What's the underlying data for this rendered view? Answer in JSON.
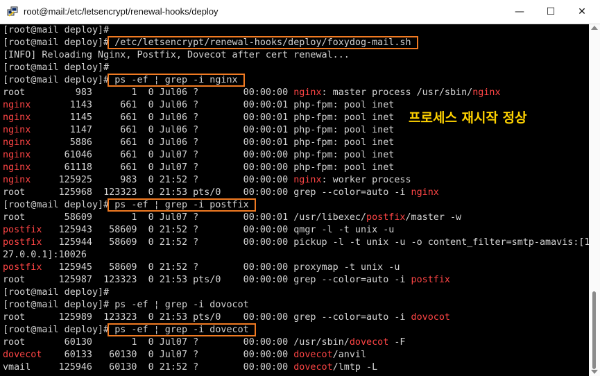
{
  "window": {
    "title": "root@mail:/etc/letsencrypt/renewal-hooks/deploy",
    "minimize_glyph": "—",
    "maximize_glyph": "☐",
    "close_glyph": "✕"
  },
  "annotation": "프로세스 재시작 정상",
  "colors": {
    "highlight_text": "#ff4545",
    "box_outline": "#f07a22",
    "annotation": "#ffd200"
  },
  "terminal": {
    "lines": [
      {
        "segs": [
          {
            "t": "[root@mail deploy]#"
          }
        ]
      },
      {
        "segs": [
          {
            "t": "[root@mail deploy]#"
          },
          {
            "t": " /etc/letsencrypt/renewal-hooks/deploy/foxydog-mail.sh ",
            "box": true
          }
        ]
      },
      {
        "segs": [
          {
            "t": "[INFO] Reloading Nginx, Postfix, Dovecot after cert renewal..."
          }
        ]
      },
      {
        "segs": [
          {
            "t": "[root@mail deploy]#"
          }
        ]
      },
      {
        "segs": [
          {
            "t": "[root@mail deploy]#"
          },
          {
            "t": " ps -ef ¦ grep -i nginx ",
            "box": true
          }
        ]
      },
      {
        "segs": [
          {
            "t": "root         983       1  0 Jul06 ?        00:00:00 "
          },
          {
            "t": "nginx",
            "red": true
          },
          {
            "t": ": master process /usr/sbin/"
          },
          {
            "t": "nginx",
            "red": true
          }
        ]
      },
      {
        "segs": [
          {
            "t": "nginx",
            "red": true
          },
          {
            "t": "       1143     661  0 Jul06 ?        00:00:01 php-fpm: pool inet"
          }
        ]
      },
      {
        "segs": [
          {
            "t": "nginx",
            "red": true
          },
          {
            "t": "       1145     661  0 Jul06 ?        00:00:01 php-fpm: pool inet"
          }
        ]
      },
      {
        "segs": [
          {
            "t": "nginx",
            "red": true
          },
          {
            "t": "       1147     661  0 Jul06 ?        00:00:01 php-fpm: pool inet"
          }
        ]
      },
      {
        "segs": [
          {
            "t": "nginx",
            "red": true
          },
          {
            "t": "       5886     661  0 Jul06 ?        00:00:01 php-fpm: pool inet"
          }
        ]
      },
      {
        "segs": [
          {
            "t": "nginx",
            "red": true
          },
          {
            "t": "      61046     661  0 Jul07 ?        00:00:00 php-fpm: pool inet"
          }
        ]
      },
      {
        "segs": [
          {
            "t": "nginx",
            "red": true
          },
          {
            "t": "      61118     661  0 Jul07 ?        00:00:00 php-fpm: pool inet"
          }
        ]
      },
      {
        "segs": [
          {
            "t": "nginx",
            "red": true
          },
          {
            "t": "     125925     983  0 21:52 ?        00:00:00 "
          },
          {
            "t": "nginx",
            "red": true
          },
          {
            "t": ": worker process"
          }
        ]
      },
      {
        "segs": [
          {
            "t": "root      125968  123323  0 21:53 pts/0    00:00:00 grep --color=auto -i "
          },
          {
            "t": "nginx",
            "red": true
          }
        ]
      },
      {
        "segs": [
          {
            "t": "[root@mail deploy]#"
          },
          {
            "t": " ps -ef ¦ grep -i postfix ",
            "box": true
          }
        ]
      },
      {
        "segs": [
          {
            "t": "root       58609       1  0 Jul07 ?        00:00:01 /usr/libexec/"
          },
          {
            "t": "postfix",
            "red": true
          },
          {
            "t": "/master -w"
          }
        ]
      },
      {
        "segs": [
          {
            "t": "postfix",
            "red": true
          },
          {
            "t": "   125943   58609  0 21:52 ?        00:00:00 qmgr -l -t unix -u"
          }
        ]
      },
      {
        "segs": [
          {
            "t": "postfix",
            "red": true
          },
          {
            "t": "   125944   58609  0 21:52 ?        00:00:00 pickup -l -t unix -u -o content_filter=smtp-amavis:[1"
          }
        ]
      },
      {
        "segs": [
          {
            "t": "27.0.0.1]:10026"
          }
        ]
      },
      {
        "segs": [
          {
            "t": "postfix",
            "red": true
          },
          {
            "t": "   125945   58609  0 21:52 ?        00:00:00 proxymap -t unix -u"
          }
        ]
      },
      {
        "segs": [
          {
            "t": "root      125987  123323  0 21:53 pts/0    00:00:00 grep --color=auto -i "
          },
          {
            "t": "postfix",
            "red": true
          }
        ]
      },
      {
        "segs": [
          {
            "t": "[root@mail deploy]#"
          }
        ]
      },
      {
        "segs": [
          {
            "t": "[root@mail deploy]# ps -ef ¦ grep -i dovocot"
          }
        ]
      },
      {
        "segs": [
          {
            "t": "root      125989  123323  0 21:53 pts/0    00:00:00 grep --color=auto -i "
          },
          {
            "t": "dovocot",
            "red": true
          }
        ]
      },
      {
        "segs": [
          {
            "t": "[root@mail deploy]#"
          },
          {
            "t": " ps -ef ¦ grep -i dovecot ",
            "box": true
          }
        ]
      },
      {
        "segs": [
          {
            "t": "root       60130       1  0 Jul07 ?        00:00:00 /usr/sbin/"
          },
          {
            "t": "dovecot",
            "red": true
          },
          {
            "t": " -F"
          }
        ]
      },
      {
        "segs": [
          {
            "t": "dovecot",
            "red": true
          },
          {
            "t": "    60133   60130  0 Jul07 ?        00:00:00 "
          },
          {
            "t": "dovecot",
            "red": true
          },
          {
            "t": "/anvil"
          }
        ]
      },
      {
        "segs": [
          {
            "t": "vmail     125946   60130  0 21:52 ?        00:00:00 "
          },
          {
            "t": "dovecot",
            "red": true
          },
          {
            "t": "/lmtp -L"
          }
        ]
      }
    ]
  }
}
